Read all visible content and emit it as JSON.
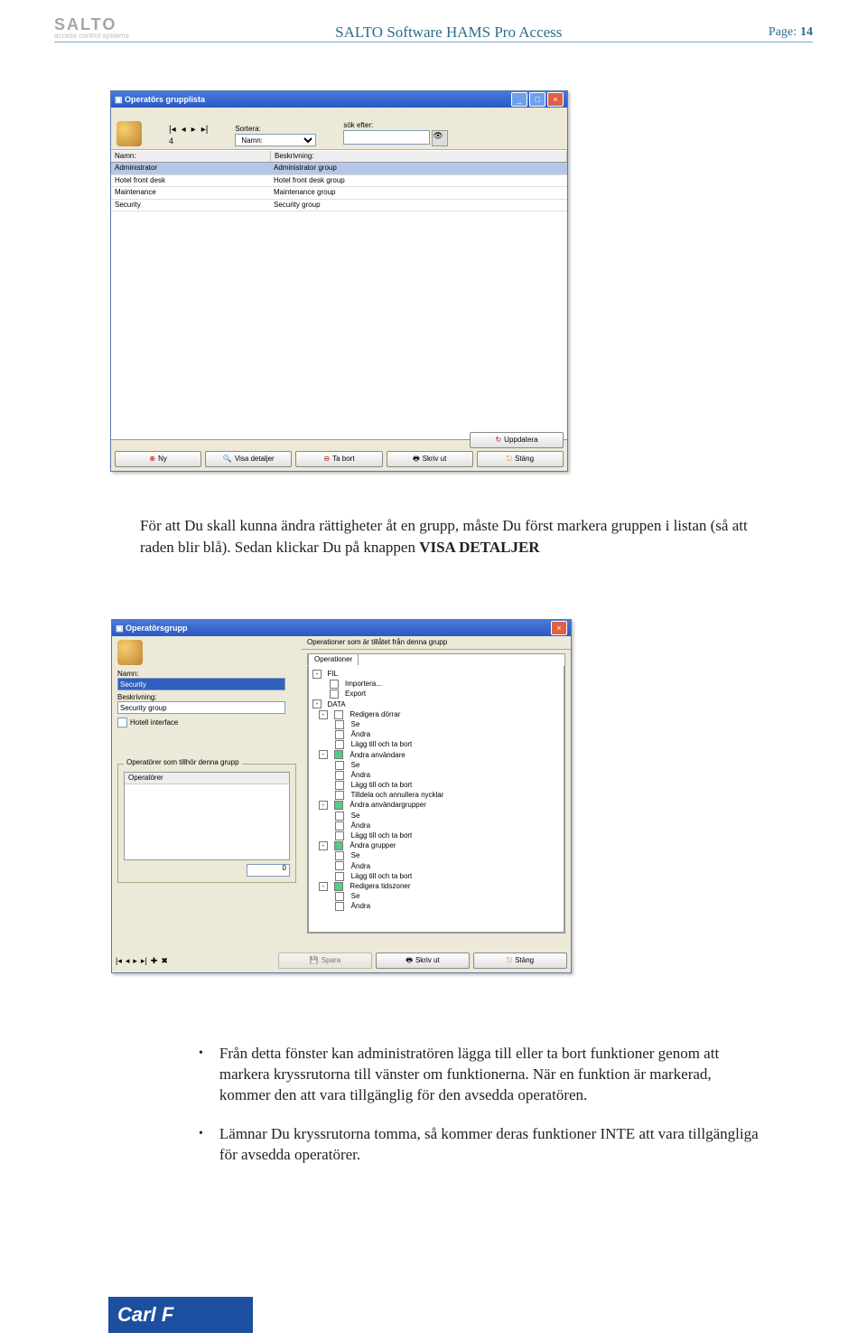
{
  "header": {
    "logo": "SALTO",
    "title": "SALTO Software HAMS Pro Access",
    "page_label": "Page:",
    "page_number": "14"
  },
  "win1": {
    "title": "Operatörs grupplista",
    "record_count": "4",
    "sort_label": "Sortera:",
    "sort_value": "Namn:",
    "search_label": "sök efter:",
    "columns": {
      "name": "Namn:",
      "desc": "Beskrivning:"
    },
    "rows": [
      {
        "name": "Administrator",
        "desc": "Administrator group"
      },
      {
        "name": "Hotel front desk",
        "desc": "Hotel front desk group"
      },
      {
        "name": "Maintenance",
        "desc": "Maintenance group"
      },
      {
        "name": "Security",
        "desc": "Security group"
      }
    ],
    "buttons": {
      "update": "Uppdatera",
      "new": "Ny",
      "details": "Visa detaljer",
      "delete": "Ta bort",
      "print": "Skriv ut",
      "close": "Stäng"
    }
  },
  "para1": {
    "t1": "För att Du skall kunna ändra rättigheter åt en grupp, måste Du först markera gruppen i listan (så att raden blir blå). Sedan klickar Du på knappen ",
    "t2": "VISA DETALJER"
  },
  "win2": {
    "title": "Operatörsgrupp",
    "name_label": "Namn:",
    "name_value": "Security",
    "desc_label": "Beskrivning:",
    "desc_value": "Security group",
    "hotel_interface": "Hotell interface",
    "group_legend": "Operatörer som tillhör denna grupp",
    "op_col": "Operatörer",
    "op_count": "0",
    "right_header": "Operationer som är tillåtet från denna grupp",
    "tab": "Operationer",
    "tree": [
      "[-]  FIL",
      "       [ ]  Importera...",
      "       [ ]  Export",
      "[-]  DATA",
      "   [-] [ ]  Redigera dörrar",
      "          [ ]  Se",
      "          [ ]  Ändra",
      "          [ ]  Lägg till och ta bort",
      "   [-] [x]  Ändra användare",
      "          [ ]  Se",
      "          [ ]  Ändra",
      "          [ ]  Lägg till och ta bort",
      "          [ ]  Tilldela och annullera nycklar",
      "   [-] [x]  Ändra användargrupper",
      "          [ ]  Se",
      "          [ ]  Ändra",
      "          [ ]  Lägg till och ta bort",
      "   [-] [x]  Ändra grupper",
      "          [ ]  Se",
      "          [ ]  Ändra",
      "          [ ]  Lägg till och ta bort",
      "   [-] [x]  Redigera tidszoner",
      "          [ ]  Se",
      "          [ ]  Ändra"
    ],
    "buttons": {
      "save": "Spara",
      "print": "Skriv ut",
      "close": "Stäng"
    }
  },
  "bullets": [
    "Från detta fönster kan administratören lägga till eller ta bort funktioner genom att markera kryssrutorna till vänster om funktionerna. När en funktion är markerad, kommer den att vara tillgänglig för den avsedda operatören.",
    "Lämnar Du kryssrutorna tomma, så kommer deras funktioner INTE att vara tillgängliga för avsedda operatörer."
  ],
  "footer_logo": "Carl F"
}
